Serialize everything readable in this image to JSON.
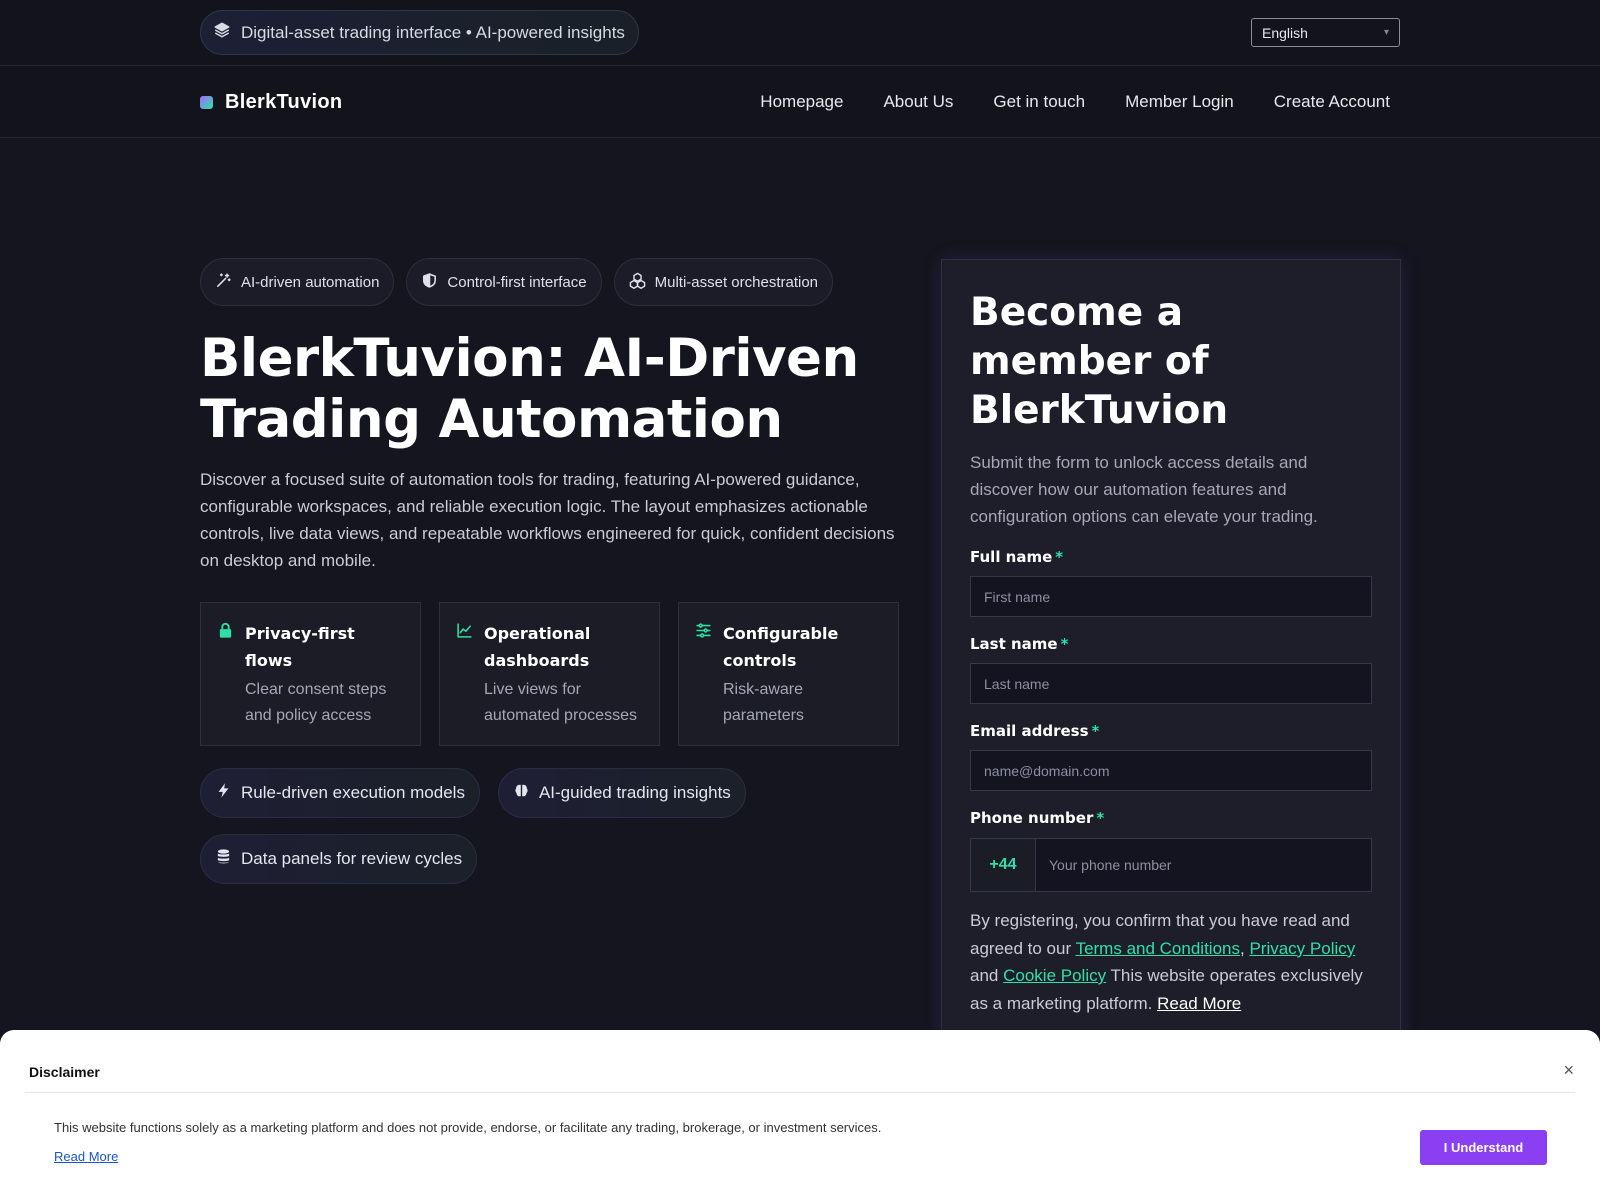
{
  "topbar": {
    "pill_text": "Digital-asset trading interface • AI-powered insights",
    "pill_icon": "layers-icon",
    "language": "English"
  },
  "nav": {
    "brand": "BlerkTuvion",
    "links": [
      "Homepage",
      "About Us",
      "Get in touch",
      "Member Login",
      "Create Account"
    ]
  },
  "hero": {
    "chips": [
      {
        "label": "AI-driven automation",
        "icon": "magic-wand-icon"
      },
      {
        "label": "Control-first interface",
        "icon": "shield-icon"
      },
      {
        "label": "Multi-asset orchestration",
        "icon": "cubes-icon"
      }
    ],
    "title": "BlerkTuvion: AI-Driven Trading Automation",
    "description": "Discover a focused suite of automation tools for trading, featuring AI-powered guidance, configurable workspaces, and reliable execution logic. The layout emphasizes actionable controls, live data views, and repeatable workflows engineered for quick, confident decisions on desktop and mobile.",
    "features": [
      {
        "title": "Privacy-first flows",
        "text": "Clear consent steps and policy access",
        "icon": "lock-icon"
      },
      {
        "title": "Operational dashboards",
        "text": "Live views for automated processes",
        "icon": "chart-line-icon"
      },
      {
        "title": "Configurable controls",
        "text": "Risk-aware parameters",
        "icon": "sliders-icon"
      }
    ],
    "tags": [
      {
        "label": "Rule-driven execution models",
        "icon": "bolt-icon"
      },
      {
        "label": "AI-guided trading insights",
        "icon": "brain-icon"
      },
      {
        "label": "Data panels for review cycles",
        "icon": "database-icon"
      }
    ]
  },
  "form": {
    "title": "Become a member of BlerkTuvion",
    "subtitle": "Submit the form to unlock access details and discover how our automation features and configuration options can elevate your trading.",
    "fields": {
      "first_label": "Full name",
      "first_placeholder": "First name",
      "last_label": "Last name",
      "last_placeholder": "Last name",
      "email_label": "Email address",
      "email_placeholder": "name@domain.com",
      "phone_label": "Phone number",
      "phone_code": "+44",
      "phone_placeholder": "Your phone number",
      "required_mark": "*"
    },
    "legal": {
      "prefix": "By registering, you confirm that you have read and agreed to our",
      "terms": "Terms and Conditions",
      "comma": ",",
      "privacy": "Privacy Policy",
      "and": "and",
      "cookie": "Cookie Policy",
      "suffix": "This website operates exclusively as a marketing platform.",
      "read_more": "Read More"
    }
  },
  "disclaimer": {
    "title": "Disclaimer",
    "close": "×",
    "text": "This website functions solely as a marketing platform and does not provide, endorse, or facilitate any trading, brokerage, or investment services.",
    "read_more": "Read More",
    "button": "I Understand"
  },
  "colors": {
    "accent_green": "#2fe0a6",
    "accent_purple": "#8a3ff2",
    "background": "#14151e"
  }
}
